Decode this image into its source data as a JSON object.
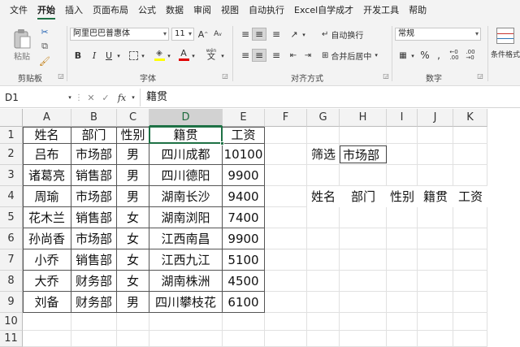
{
  "menu": {
    "tabs": [
      "文件",
      "开始",
      "插入",
      "页面布局",
      "公式",
      "数据",
      "审阅",
      "视图",
      "自动执行",
      "Excel自学成才",
      "开发工具",
      "帮助"
    ],
    "active_index": 1
  },
  "ribbon": {
    "clipboard": {
      "paste_label": "粘贴",
      "group_label": "剪贴板"
    },
    "font": {
      "font_name": "阿里巴巴普惠体",
      "font_size": "11",
      "bold": "B",
      "italic": "I",
      "underline": "U",
      "font_color_letter": "A",
      "wen": "wén",
      "group_label": "字体"
    },
    "alignment": {
      "wrap_text": "自动换行",
      "merge_center": "合并后居中",
      "group_label": "对齐方式"
    },
    "number": {
      "format": "常规",
      "percent": "%",
      "group_label": "数字"
    },
    "styles": {
      "conditional_format": "条件格式"
    },
    "colors": {
      "accent": "#1e7145",
      "font_color_bar": "#e00000",
      "fill_color_bar": "#ffff00"
    }
  },
  "formula_bar": {
    "name_box": "D1",
    "cancel": "✕",
    "confirm": "✓",
    "fx": "fx",
    "content": "籍贯"
  },
  "sheet": {
    "columns": [
      "A",
      "B",
      "C",
      "D",
      "E",
      "F",
      "G",
      "H",
      "I",
      "J",
      "K"
    ],
    "rows": [
      "1",
      "2",
      "3",
      "4",
      "5",
      "6",
      "7",
      "8",
      "9",
      "10",
      "11"
    ],
    "selected_column": "D",
    "table": [
      [
        "姓名",
        "部门",
        "性别",
        "籍贯",
        "工资"
      ],
      [
        "吕布",
        "市场部",
        "男",
        "四川成都",
        "10100"
      ],
      [
        "诸葛亮",
        "销售部",
        "男",
        "四川德阳",
        "9900"
      ],
      [
        "周瑜",
        "市场部",
        "男",
        "湖南长沙",
        "9400"
      ],
      [
        "花木兰",
        "销售部",
        "女",
        "湖南浏阳",
        "7400"
      ],
      [
        "孙尚香",
        "市场部",
        "女",
        "江西南昌",
        "9900"
      ],
      [
        "小乔",
        "销售部",
        "女",
        "江西九江",
        "5100"
      ],
      [
        "大乔",
        "财务部",
        "女",
        "湖南株洲",
        "4500"
      ],
      [
        "刘备",
        "财务部",
        "男",
        "四川攀枝花",
        "6100"
      ]
    ],
    "filter_label": "筛选",
    "filter_value": "市场部",
    "result_headers": [
      "姓名",
      "部门",
      "性别",
      "籍贯",
      "工资"
    ]
  }
}
